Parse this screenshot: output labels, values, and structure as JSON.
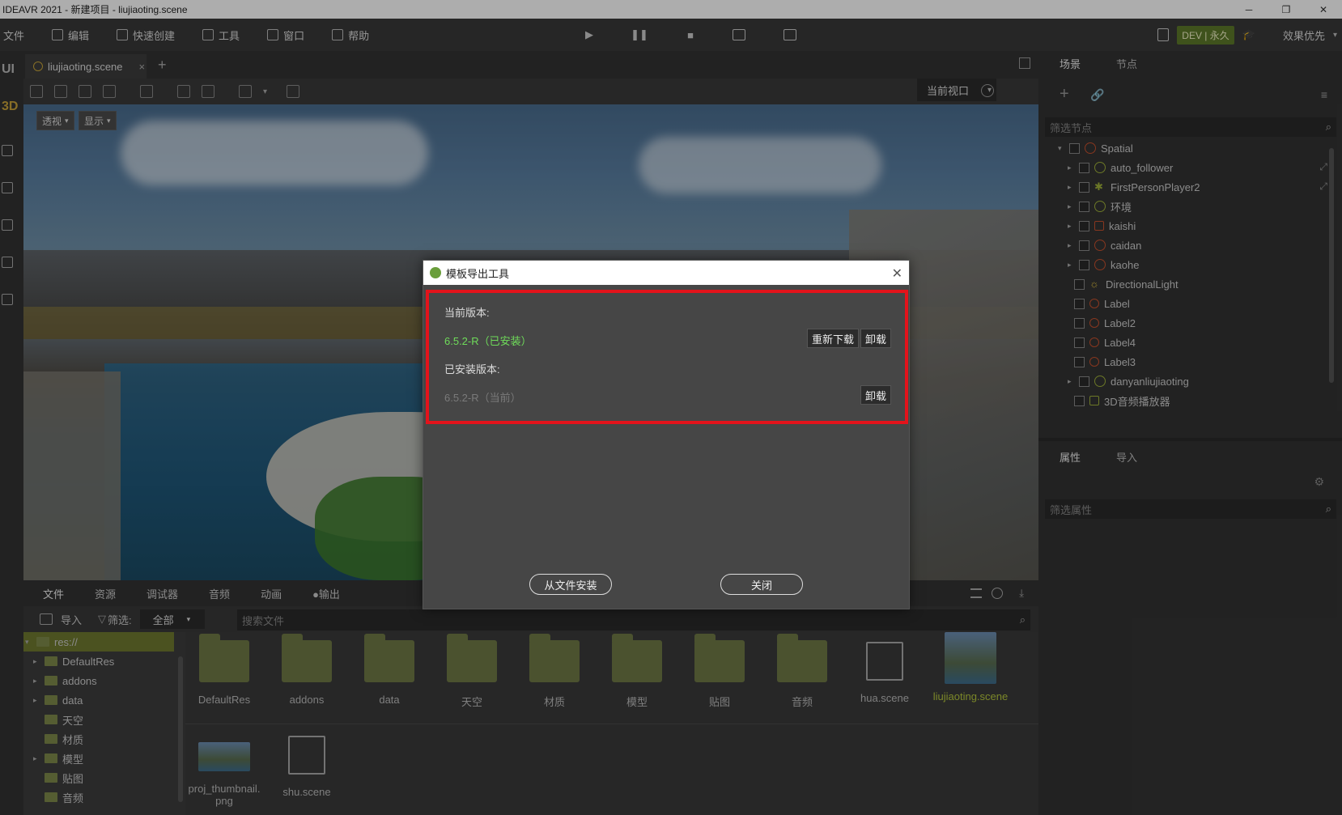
{
  "window": {
    "title": "IDEAVR 2021 - 新建项目 - liujiaoting.scene",
    "minimize_icon": "minimize-icon",
    "restore_icon": "restore-icon",
    "close_icon": "close-icon"
  },
  "menu": {
    "items": [
      {
        "label": "文件",
        "icon": "file-icon"
      },
      {
        "label": "编辑",
        "icon": "crop-icon"
      },
      {
        "label": "快速创建",
        "icon": "edit-icon"
      },
      {
        "label": "工具",
        "icon": "toolbox-icon"
      },
      {
        "label": "窗口",
        "icon": "window-icon"
      },
      {
        "label": "帮助",
        "icon": "help-book-icon"
      }
    ]
  },
  "playbar": {
    "play": "▶",
    "pause": "❚❚",
    "stop": "■",
    "play_scene": "🎬",
    "play_custom": "🎬"
  },
  "right_menu": {
    "dev": "DEV | 永久",
    "mode": "效果优先"
  },
  "left_strip": {
    "ui": "UI",
    "3d": "3D"
  },
  "scene_tab": {
    "label": "liujiaoting.scene",
    "close": "×",
    "add": "+"
  },
  "viewport_select": {
    "label": "当前视口"
  },
  "viewport": {
    "perspective": "透视",
    "display": "显示"
  },
  "bottom_tabs": [
    "文件",
    "资源",
    "调试器",
    "音频",
    "动画",
    "●输出"
  ],
  "filesystem": {
    "import": "导入",
    "filter_label": "筛选:",
    "filter_value": "全部",
    "search_placeholder": "搜索文件"
  },
  "tree": [
    {
      "label": "res://",
      "selected": true
    },
    {
      "label": "DefaultRes",
      "arrow": true
    },
    {
      "label": "addons",
      "arrow": true
    },
    {
      "label": "data",
      "arrow": true
    },
    {
      "label": "天空",
      "arrow": false
    },
    {
      "label": "材质",
      "arrow": false
    },
    {
      "label": "模型",
      "arrow": true
    },
    {
      "label": "贴图",
      "arrow": false
    },
    {
      "label": "音频",
      "arrow": false
    }
  ],
  "files": [
    {
      "label": "DefaultRes",
      "kind": "folder"
    },
    {
      "label": "addons",
      "kind": "folder"
    },
    {
      "label": "data",
      "kind": "folder"
    },
    {
      "label": "天空",
      "kind": "folder"
    },
    {
      "label": "材质",
      "kind": "folder"
    },
    {
      "label": "模型",
      "kind": "folder"
    },
    {
      "label": "贴图",
      "kind": "folder"
    },
    {
      "label": "音频",
      "kind": "folder"
    },
    {
      "label": "hua.scene",
      "kind": "scene"
    },
    {
      "label": "liujiaoting.scene",
      "kind": "thumb",
      "highlight": true
    },
    {
      "label": "proj_thumbnail.png",
      "kind": "thumb"
    },
    {
      "label": "shu.scene",
      "kind": "scene"
    }
  ],
  "right_panel": {
    "tab_scene": "场景",
    "tab_node": "节点",
    "filter_nodes": "筛选节点",
    "nodes": [
      {
        "label": "Spatial",
        "icon": "circle",
        "arrow": "▾",
        "checked": true
      },
      {
        "label": "auto_follower",
        "icon": "circle",
        "arrow": "▸",
        "checked": true
      },
      {
        "label": "FirstPersonPlayer2",
        "icon": "person",
        "arrow": "▸",
        "checked": true
      },
      {
        "label": "环境",
        "icon": "circle",
        "arrow": "▸",
        "checked": true
      },
      {
        "label": "kaishi",
        "icon": "image",
        "arrow": "▸",
        "checked": false
      },
      {
        "label": "caidan",
        "icon": "circle",
        "arrow": "▸",
        "checked": false
      },
      {
        "label": "kaohe",
        "icon": "circle",
        "arrow": "▸",
        "checked": false
      },
      {
        "label": "DirectionalLight",
        "icon": "sun",
        "arrow": "",
        "checked": false
      },
      {
        "label": "Label",
        "icon": "tag",
        "arrow": "",
        "checked": false
      },
      {
        "label": "Label2",
        "icon": "tag",
        "arrow": "",
        "checked": false
      },
      {
        "label": "Label4",
        "icon": "tag",
        "arrow": "",
        "checked": false
      },
      {
        "label": "Label3",
        "icon": "tag",
        "arrow": "",
        "checked": false
      },
      {
        "label": "danyanliujiaoting",
        "icon": "circle",
        "arrow": "▸",
        "checked": true
      },
      {
        "label": "3D音频播放器",
        "icon": "audio",
        "arrow": "",
        "checked": true
      }
    ],
    "tab_props": "属性",
    "tab_import": "导入",
    "filter_props": "筛选属性"
  },
  "dialog": {
    "title": "模板导出工具",
    "current_version_label": "当前版本:",
    "current_version": "6.5.2-R（已安装）",
    "redownload": "重新下载",
    "uninstall": "卸载",
    "installed_label": "已安装版本:",
    "installed_version": "6.5.2-R（当前）",
    "uninstall2": "卸载",
    "install_from_file": "从文件安装",
    "close": "关闭"
  },
  "colors": {
    "accent_green": "#6fdc5a",
    "highlight_red": "#e3131b",
    "folder": "#6f7a46",
    "dev_badge": "#5d7a2a"
  }
}
